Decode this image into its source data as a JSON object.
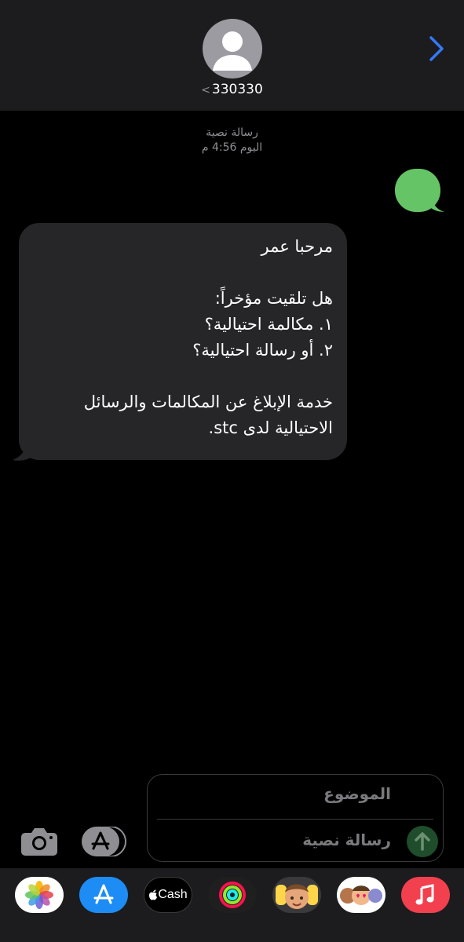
{
  "header": {
    "contact_number": "330330",
    "back_chevron": "<",
    "avatar_icon": "person-silhouette-icon",
    "forward_icon": "chevron-right-icon"
  },
  "thread": {
    "message_type_label": "رسالة نصية",
    "timestamp": "اليوم 4:56 م"
  },
  "message": {
    "text": "مرحبا عمر\n\nهل تلقيت مؤخراً:\n١. مكالمة احتيالية؟\n٢. أو رسالة احتيالية؟\n\nخدمة الإبلاغ عن المكالمات والرسائل الاحتيالية لدى stc."
  },
  "composer": {
    "subject_placeholder": "الموضوع",
    "message_placeholder": "رسالة نصية",
    "camera_icon": "camera-icon",
    "apps_icon": "app-store-icon",
    "send_icon": "send-arrow-icon"
  },
  "dock": {
    "apps": [
      {
        "name": "photos",
        "icon": "photos-icon"
      },
      {
        "name": "app-store",
        "icon": "app-store-icon"
      },
      {
        "name": "apple-cash",
        "label": "Cash",
        "icon": "apple-logo-icon"
      },
      {
        "name": "fitness",
        "icon": "activity-rings-icon"
      },
      {
        "name": "memoji",
        "icon": "memoji-icon"
      },
      {
        "name": "memoji-stickers",
        "icon": "memoji-stickers-icon"
      },
      {
        "name": "music",
        "icon": "music-note-icon"
      }
    ]
  },
  "colors": {
    "background": "#000000",
    "header_bg": "#1c1c1e",
    "incoming_bubble": "#262628",
    "outgoing_bubble": "#65c466",
    "accent_blue": "#3478f6",
    "secondary_text": "#8e8e93"
  }
}
